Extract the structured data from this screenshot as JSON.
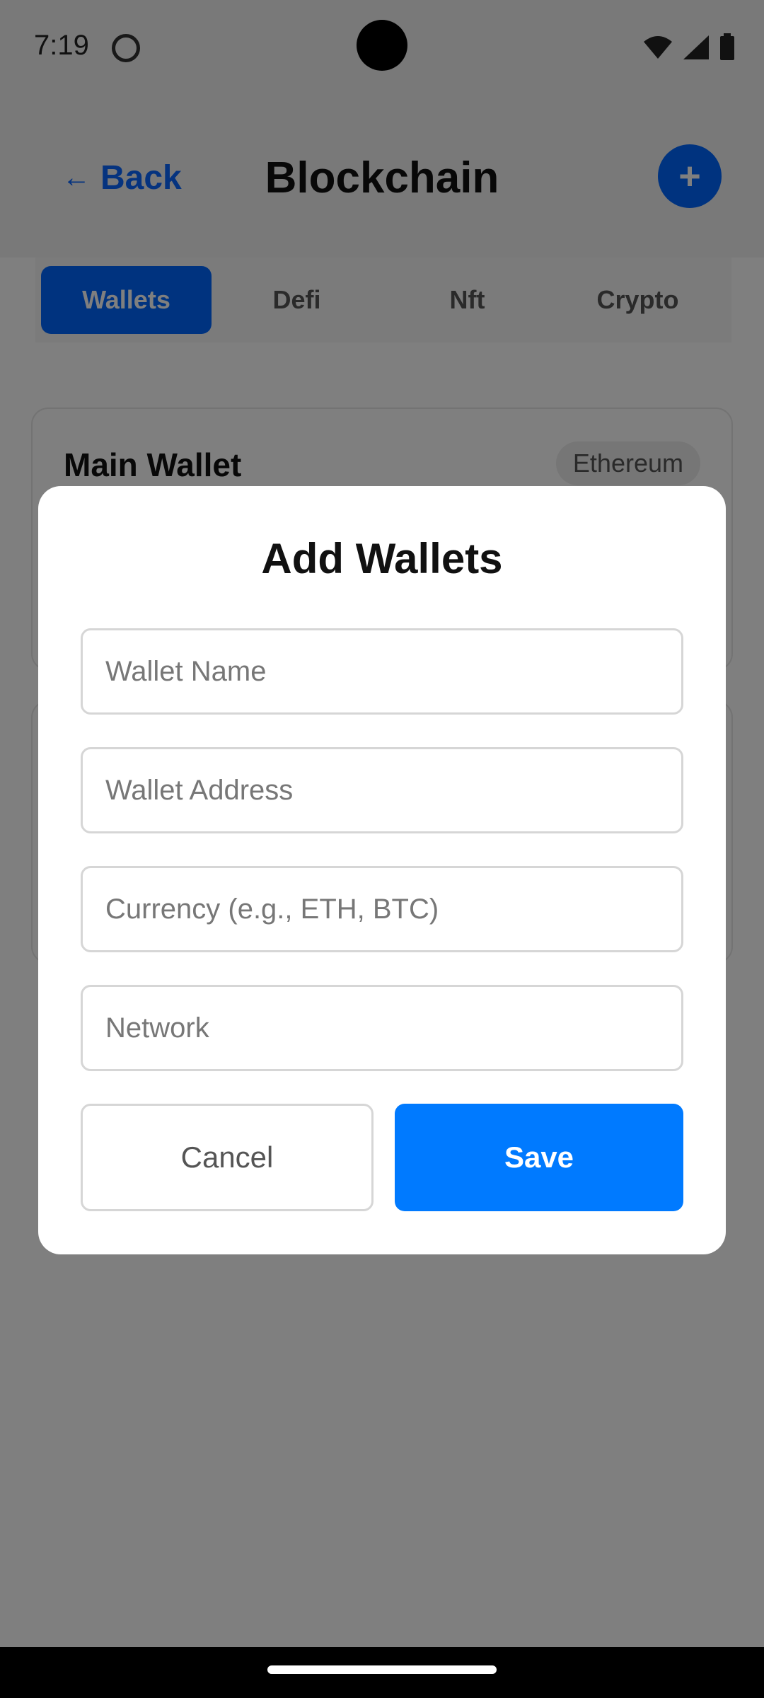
{
  "status_bar": {
    "time": "7:19",
    "icons": [
      "app-notification-icon",
      "wifi-icon",
      "signal-icon",
      "battery-icon"
    ]
  },
  "header": {
    "back_label": "Back",
    "back_arrow": "←",
    "title": "Blockchain",
    "add_label": "+"
  },
  "tabs": [
    {
      "label": "Wallets",
      "active": true
    },
    {
      "label": "Defi",
      "active": false
    },
    {
      "label": "Nft",
      "active": false
    },
    {
      "label": "Crypto",
      "active": false
    }
  ],
  "cards": [
    {
      "title": "Main Wallet",
      "badge": "Ethereum"
    }
  ],
  "modal": {
    "title": "Add Wallets",
    "fields": [
      {
        "placeholder": "Wallet Name",
        "value": ""
      },
      {
        "placeholder": "Wallet Address",
        "value": ""
      },
      {
        "placeholder": "Currency (e.g., ETH, BTC)",
        "value": ""
      },
      {
        "placeholder": "Network",
        "value": ""
      }
    ],
    "cancel_label": "Cancel",
    "save_label": "Save"
  },
  "colors": {
    "accent": "#007aff",
    "scrim": "rgba(0,0,0,0.5)"
  }
}
